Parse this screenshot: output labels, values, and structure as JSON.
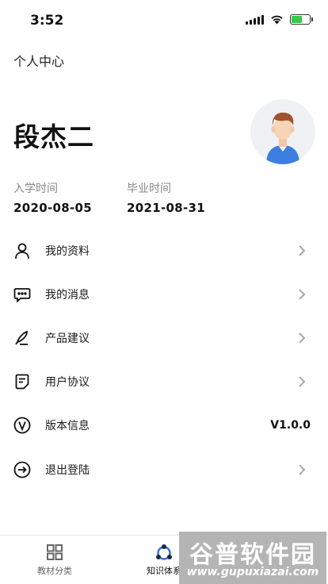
{
  "status_bar": {
    "time": "3:52",
    "battery_charge": 0.6
  },
  "header": {
    "title": "个人中心"
  },
  "profile": {
    "name": "段杰二",
    "enroll_label": "入学时间",
    "enroll_date": "2020-08-05",
    "graduate_label": "毕业时间",
    "graduate_date": "2021-08-31"
  },
  "menu": {
    "items": [
      {
        "label": "我的资料",
        "icon": "user-icon"
      },
      {
        "label": "我的消息",
        "icon": "message-icon"
      },
      {
        "label": "产品建议",
        "icon": "pen-icon"
      },
      {
        "label": "用户协议",
        "icon": "document-icon"
      },
      {
        "label": "版本信息",
        "icon": "version-icon",
        "value": "V1.0.0"
      },
      {
        "label": "退出登陆",
        "icon": "logout-icon"
      }
    ]
  },
  "tab_bar": {
    "tabs": [
      {
        "label": "教材分类",
        "icon": "grid-icon"
      },
      {
        "label": "知识体系",
        "icon": "knowledge-icon"
      }
    ]
  },
  "watermark": {
    "title": "谷普软件园",
    "url": "www.gupuxiazai.com"
  },
  "colors": {
    "battery_green": "#38c94c",
    "avatar_shirt": "#3d7fe0",
    "avatar_hair": "#a0522d",
    "accent_blue": "#2f6fd6"
  }
}
